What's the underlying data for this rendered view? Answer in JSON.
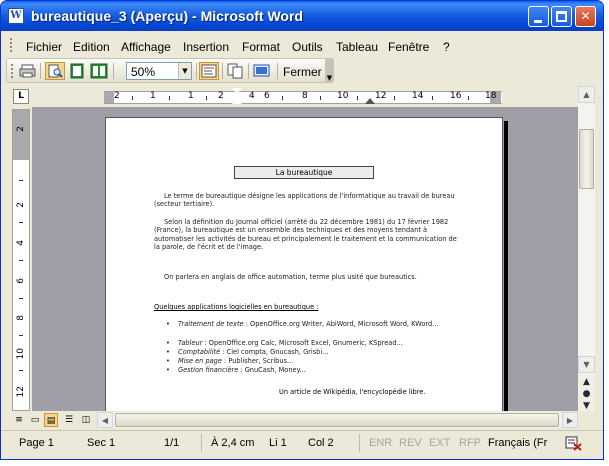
{
  "window": {
    "title": "bureautique_3 (Aperçu) - Microsoft Word",
    "app_icon_letter": "W"
  },
  "menu": {
    "items": [
      {
        "label": "Fichier",
        "accel": "F"
      },
      {
        "label": "Edition",
        "accel": "E"
      },
      {
        "label": "Affichage",
        "accel": "A"
      },
      {
        "label": "Insertion",
        "accel": "I"
      },
      {
        "label": "Format",
        "accel": "m"
      },
      {
        "label": "Outils",
        "accel": "O"
      },
      {
        "label": "Tableau",
        "accel": "b"
      },
      {
        "label": "Fenêtre",
        "accel": "n"
      },
      {
        "label": "?",
        "accel": "?"
      }
    ]
  },
  "toolbar": {
    "zoom_value": "50%",
    "close_label": "Fermer"
  },
  "ruler": {
    "tab_selector": "L",
    "h_labels": [
      "2",
      "1",
      "1",
      "2",
      "4",
      "6",
      "8",
      "10",
      "12",
      "14",
      "16",
      "18"
    ],
    "v_labels": [
      "2",
      "2",
      "4",
      "6",
      "8",
      "10",
      "12"
    ]
  },
  "document": {
    "title": "La bureautique",
    "paragraphs": [
      "Le terme de bureautique désigne les applications de l'informatique au travail de bureau (secteur tertiaire).",
      "Selon la définition du Journal officiel (arrêté du 22 décembre 1981) du 17 février 1982 (France), la bureautique est un ensemble des techniques et des moyens tendant à automatiser les activités de bureau et principalement le traitement et la communication de la parole, de l'écrit et de l'image.",
      "On parlera en anglais de office automation, terme plus usité que bureautics."
    ],
    "subtitle": "Quelques applications logicielles en bureautique :",
    "bullets": [
      {
        "term": "Traitement de texte",
        "text": " : OpenOffice.org Writer, AbiWord, Microsoft Word, KWord..."
      },
      {
        "term": "Tableur",
        "text": " : OpenOffice.org Calc, Microsoft Excel, Gnumeric, KSpread..."
      },
      {
        "term": "Comptabilité",
        "text": " : Ciel compta, Gnucash, Grisbi..."
      },
      {
        "term": "Mise en page",
        "text": " : Publisher, Scribus..."
      },
      {
        "term": "Gestion financière",
        "text": " : GnuCash, Money..."
      }
    ],
    "credit": "Un article de Wikipédia, l'encyclopédie libre."
  },
  "status": {
    "page": "Page  1",
    "section": "Sec  1",
    "page_of": "1/1",
    "at": "À  2,4 cm",
    "line": "Li  1",
    "col": "Col  2",
    "rec": "ENR",
    "rev": "REV",
    "ext": "EXT",
    "ovr": "RFP",
    "lang": "Français (Fr"
  },
  "colors": {
    "titlebar": "#0047d4",
    "workspace": "#a09fa8",
    "active_button": "#f7d58c"
  }
}
